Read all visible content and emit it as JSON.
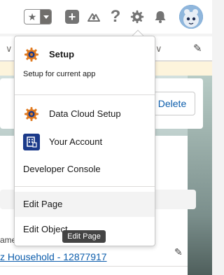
{
  "header": {
    "favorites_star": "★",
    "help_glyph": "?"
  },
  "page": {
    "delete_label": "Delete",
    "name_label": "ame",
    "name_value": "z Household - 12877917"
  },
  "menu": {
    "setup_title": "Setup",
    "setup_subtitle": "Setup for current app",
    "items": [
      {
        "label": "Data Cloud Setup"
      },
      {
        "label": "Your Account"
      },
      {
        "label": "Developer Console"
      },
      {
        "label": "Edit Page"
      },
      {
        "label": "Edit Object"
      }
    ]
  },
  "tooltip": "Edit Page",
  "colors": {
    "brand_blue": "#0b5cab",
    "gear_orange": "#e07a1f",
    "icon_grey": "#747474"
  },
  "icons": [
    "star-icon",
    "chevron-down-icon",
    "plus-icon",
    "trailhead-icon",
    "help-icon",
    "gear-icon",
    "bell-icon",
    "avatar",
    "pencil-icon",
    "account-icon"
  ]
}
